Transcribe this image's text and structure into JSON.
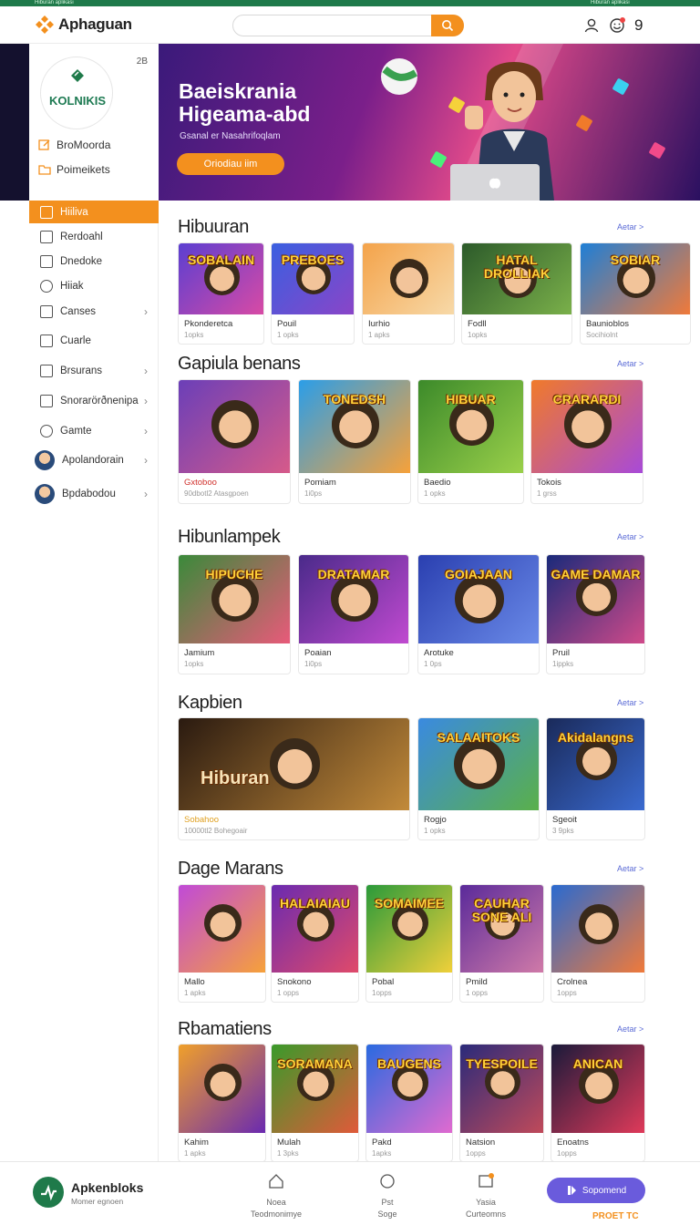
{
  "top_strip": {
    "left": "Hiburan aplikasi",
    "right": "Hiburan aplikasi"
  },
  "header": {
    "app_name": "Aphaguan",
    "search_placeholder": "",
    "badge_number": "9"
  },
  "sidebar": {
    "brand": "KOLNIKIS",
    "brand_count": "2B",
    "quick": [
      "BroMoorda",
      "Poimeikets"
    ],
    "items": [
      {
        "label": "Hiiliva",
        "active": true,
        "chevron": false
      },
      {
        "label": "Rerdoahl",
        "active": false,
        "chevron": false
      },
      {
        "label": "Dnedoke",
        "active": false,
        "chevron": false
      },
      {
        "label": "Hiiak",
        "active": false,
        "chevron": false
      },
      {
        "label": "Canses",
        "active": false,
        "chevron": true
      },
      {
        "label": "Cuarle",
        "active": false,
        "chevron": false
      },
      {
        "label": "Brsurans",
        "active": false,
        "chevron": true
      },
      {
        "label": "Snorarörðnenipa",
        "active": false,
        "chevron": true
      },
      {
        "label": "Gamte",
        "active": false,
        "chevron": true
      },
      {
        "label": "Apolandorain",
        "active": false,
        "chevron": true,
        "avatar": true
      },
      {
        "label": "Bpdabodou",
        "active": false,
        "chevron": true,
        "avatar": true
      }
    ]
  },
  "hero": {
    "title_line1": "Baeiskrania",
    "title_line2": "Higeama-abd",
    "subtitle": "Gsanal er Nasahrifoqlam",
    "cta": "Oriodiau iim"
  },
  "sections": [
    {
      "title": "Hibuuran",
      "more": "Aetar >",
      "cards": [
        {
          "name": "Pkonderetca",
          "meta": "1opks",
          "art": "SOBALAIN",
          "bg": "#5b3fd1",
          "bg2": "#d84aa5"
        },
        {
          "name": "Pouil",
          "meta": "1 opks",
          "art": "PREBOES",
          "bg": "#3a5fe0",
          "bg2": "#8a45c8"
        },
        {
          "name": "Iurhio",
          "meta": "1 apks",
          "art": "",
          "bg": "#f4a34a",
          "bg2": "#f7d9a8"
        },
        {
          "name": "Fodll",
          "meta": "1opks",
          "art": "HATAL DROLLIAK",
          "bg": "#2c5a2a",
          "bg2": "#7ab04a"
        },
        {
          "name": "Baunioblos",
          "meta": "Socihiolnt",
          "art": "SOBIAR",
          "bg": "#1f7fd6",
          "bg2": "#f07a3a"
        }
      ]
    },
    {
      "title": "Gapiula benans",
      "more": "Aetar >",
      "cards": [
        {
          "name": "Gxtoboo",
          "meta": "90dbotl2 Atasgpoen",
          "art": "",
          "bg": "#6b3fb8",
          "bg2": "#d65a8a",
          "red": true
        },
        {
          "name": "Pomiam",
          "meta": "1i0ps",
          "art": "TONEDSH",
          "bg": "#2b9ee8",
          "bg2": "#f6a13a"
        },
        {
          "name": "Baedio",
          "meta": "1 opks",
          "art": "HIBUAR",
          "bg": "#3c8a2a",
          "bg2": "#9ad04a"
        },
        {
          "name": "Tokois",
          "meta": "1 grss",
          "art": "CRARARDI",
          "bg": "#f07a2a",
          "bg2": "#a84ad8"
        }
      ]
    },
    {
      "title": "Hibunlampek",
      "more": "Aetar >",
      "cards": [
        {
          "name": "Jamium",
          "meta": "1opks",
          "art": "HIPUCHE",
          "bg": "#3a8a3a",
          "bg2": "#e85a7a"
        },
        {
          "name": "Poaian",
          "meta": "1i0ps",
          "art": "DRATAMAR",
          "bg": "#4a2a8a",
          "bg2": "#c04ad0"
        },
        {
          "name": "Arotuke",
          "meta": "1 0ps",
          "art": "GOIAJAAN",
          "bg": "#2a3fb0",
          "bg2": "#6a8ae8"
        },
        {
          "name": "Pruil",
          "meta": "1ippks",
          "art": "GAME DAMAR",
          "bg": "#1a2a7a",
          "bg2": "#d04a8a"
        }
      ]
    },
    {
      "title": "Kapbien",
      "more": "Aetar >",
      "cards": [
        {
          "name": "Sobahoo",
          "meta": "10000tl2 Bohegoair",
          "art": "Hiburan",
          "bg": "#2a1a10",
          "bg2": "#c28a3a",
          "gold": true
        },
        {
          "name": "Rogjo",
          "meta": "1 opks",
          "art": "SALAAITOKS",
          "bg": "#3a8ae0",
          "bg2": "#5ab04a"
        },
        {
          "name": "Sgeoit",
          "meta": "3 9pks",
          "art": "Akidalangns",
          "bg": "#1a2a5a",
          "bg2": "#3a6ad0"
        }
      ]
    },
    {
      "title": "Dage Marans",
      "more": "Aetar >",
      "cards": [
        {
          "name": "Mallo",
          "meta": "1 apks",
          "art": "",
          "bg": "#c04ad8",
          "bg2": "#f6a13a"
        },
        {
          "name": "Snokono",
          "meta": "1 opps",
          "art": "HALAIAIAU",
          "bg": "#6a2ab0",
          "bg2": "#e04a6a"
        },
        {
          "name": "Pobal",
          "meta": "1opps",
          "art": "SOMAIMEE",
          "bg": "#2a9a3a",
          "bg2": "#f0d03a"
        },
        {
          "name": "Pmild",
          "meta": "1 opps",
          "art": "CAUHAR SONE ALI",
          "bg": "#5a2a9a",
          "bg2": "#d07aa8"
        },
        {
          "name": "Crolnea",
          "meta": "1opps",
          "art": "",
          "bg": "#2a6ad0",
          "bg2": "#f07a3a"
        }
      ]
    },
    {
      "title": "Rbamatiens",
      "more": "Aetar >",
      "cards": [
        {
          "name": "Kahim",
          "meta": "1 apks",
          "art": "",
          "bg": "#f0a02a",
          "bg2": "#6a2ab0"
        },
        {
          "name": "Mulah",
          "meta": "1 3pks",
          "art": "SORAMANA",
          "bg": "#3a9a2a",
          "bg2": "#e05a3a"
        },
        {
          "name": "Pakd",
          "meta": "1apks",
          "art": "BAUGENS",
          "bg": "#2a6ae0",
          "bg2": "#e06ad0"
        },
        {
          "name": "Natsion",
          "meta": "1opps",
          "art": "TYESPOILE",
          "bg": "#2a2a7a",
          "bg2": "#c04a5a"
        },
        {
          "name": "Enoatns",
          "meta": "1opps",
          "art": "ANICAN",
          "bg": "#1a1a3a",
          "bg2": "#e03a5a"
        }
      ]
    }
  ],
  "bottom": {
    "app_title": "Apkenbloks",
    "app_sub": "Momer egnoen",
    "tabs": [
      {
        "l1": "Noea",
        "l2": "Teodmonimye"
      },
      {
        "l1": "Pst",
        "l2": "Soge"
      },
      {
        "l1": "Yasia",
        "l2": "Curteomns"
      }
    ],
    "cta": "Sopomend",
    "foot": "PROET TC"
  },
  "colors": {
    "accent": "#f3901e",
    "brand_green": "#1f7a4a",
    "cta_purple": "#6a5bdc"
  }
}
